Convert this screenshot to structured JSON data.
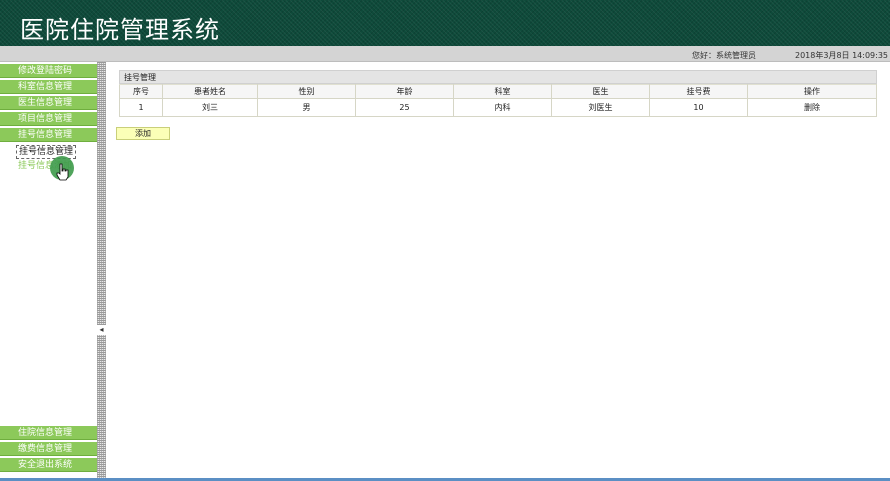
{
  "header": {
    "title": "医院住院管理系统"
  },
  "infobar": {
    "welcome": "您好：系统管理员",
    "datetime": "2018年3月8日  14:09:35"
  },
  "sidebar": {
    "top_items": [
      "修改登陆密码",
      "科室信息管理",
      "医生信息管理",
      "项目信息管理",
      "挂号信息管理"
    ],
    "sub_items": [
      "挂号信息管理",
      "挂号信息添加"
    ],
    "bottom_items": [
      "住院信息管理",
      "缴费信息管理",
      "安全退出系统"
    ]
  },
  "splitter": {
    "arrow": "◂"
  },
  "panel": {
    "title": "挂号管理",
    "columns": [
      "序号",
      "患者姓名",
      "性别",
      "年龄",
      "科室",
      "医生",
      "挂号费",
      "操作"
    ],
    "rows": [
      {
        "no": "1",
        "name": "刘三",
        "gender": "男",
        "age": "25",
        "dept": "内科",
        "doctor": "刘医生",
        "fee": "10",
        "action": "删除"
      }
    ],
    "add_label": "添加"
  },
  "colors": {
    "header_bg": "#0e4a3a",
    "menu_green": "#8cc95a",
    "add_button": "#fbffb7"
  }
}
